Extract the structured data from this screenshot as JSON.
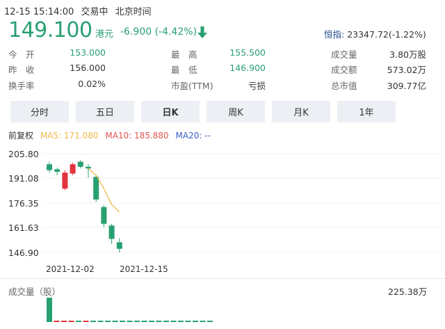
{
  "header": {
    "datetime": "12-15 15:14:00",
    "trade_status": "交易中",
    "timezone": "北京时间"
  },
  "quote": {
    "price": "149.100",
    "currency": "港元",
    "change": "-6.900 (-4.42%)",
    "hsi_label": "恒指:",
    "hsi_value": "23347.72(-1.22%)",
    "rows": [
      [
        {
          "label": "今　开",
          "value": "153.000",
          "tone": "green"
        },
        {
          "label": "最　高",
          "value": "155.500",
          "tone": "green"
        },
        {
          "label": "成交量",
          "value": "3.80万股",
          "tone": "plain"
        }
      ],
      [
        {
          "label": "昨　收",
          "value": "156.000",
          "tone": "plain"
        },
        {
          "label": "最　低",
          "value": "146.900",
          "tone": "green"
        },
        {
          "label": "成交额",
          "value": "573.02万",
          "tone": "plain"
        }
      ],
      [
        {
          "label": "换手率",
          "value": "0.02%",
          "tone": "plain"
        },
        {
          "label": "市盈(TTM)",
          "value": "亏损",
          "tone": "plain"
        },
        {
          "label": "总市值",
          "value": "309.77亿",
          "tone": "plain"
        }
      ]
    ]
  },
  "tabs": [
    "分时",
    "五日",
    "日K",
    "周K",
    "月K",
    "1年"
  ],
  "active_tab": "日K",
  "indicators": {
    "adjust": "前复权",
    "ma5": "MA5: 171.080",
    "ma10": "MA10: 185.880",
    "ma20": "MA20: --",
    "ma5_color": "#f0b94a",
    "ma10_color": "#e0554f",
    "ma20_color": "#3a5fc8"
  },
  "colors": {
    "up": "#e2323c",
    "down": "#28a071",
    "accent": "#28a071"
  },
  "chart_data": {
    "type": "candlestick",
    "y_ticks": [
      "205.80",
      "191.08",
      "176.35",
      "161.63",
      "146.90"
    ],
    "ylim": [
      146.9,
      205.8
    ],
    "x_labels": [
      "2021-12-02",
      "2021-12-15"
    ],
    "candles": [
      {
        "open": 199.5,
        "close": 196.0,
        "high": 201.0,
        "low": 194.5
      },
      {
        "open": 196.5,
        "close": 195.0,
        "high": 197.5,
        "low": 193.0
      },
      {
        "open": 185.0,
        "close": 194.5,
        "high": 196.0,
        "low": 184.0
      },
      {
        "open": 194.0,
        "close": 199.5,
        "high": 200.5,
        "low": 193.0
      },
      {
        "open": 201.0,
        "close": 198.0,
        "high": 202.0,
        "low": 197.0
      },
      {
        "open": 198.0,
        "close": 197.0,
        "high": 199.5,
        "low": 191.5
      },
      {
        "open": 192.0,
        "close": 178.5,
        "high": 193.0,
        "low": 177.0
      },
      {
        "open": 174.0,
        "close": 164.0,
        "high": 175.0,
        "low": 162.0
      },
      {
        "open": 163.0,
        "close": 155.0,
        "high": 164.0,
        "low": 152.0
      },
      {
        "open": 153.0,
        "close": 149.1,
        "high": 155.5,
        "low": 146.9
      }
    ],
    "ma5_line": [
      {
        "i": 5,
        "v": 197.0
      },
      {
        "i": 6,
        "v": 193.0
      },
      {
        "i": 7,
        "v": 185.0
      },
      {
        "i": 8,
        "v": 175.5
      },
      {
        "i": 9,
        "v": 171.08
      }
    ],
    "volume_label": "成交量（股）",
    "volume_max": "225.38万",
    "volume_max_value": 2253800,
    "volumes": [
      2253800,
      120000,
      100000,
      90000,
      40000,
      50000,
      30000,
      20000,
      20000,
      15000,
      12000,
      10000,
      10000,
      9000,
      8000,
      8000,
      6000,
      6000,
      5000,
      5000,
      5000,
      4000,
      4000
    ],
    "volume_colors": [
      "down",
      "up",
      "up",
      "up",
      "down",
      "up",
      "down",
      "down",
      "down",
      "down",
      "down",
      "down",
      "down",
      "down",
      "down",
      "down",
      "down",
      "down",
      "down",
      "down",
      "down",
      "down",
      "down"
    ]
  }
}
